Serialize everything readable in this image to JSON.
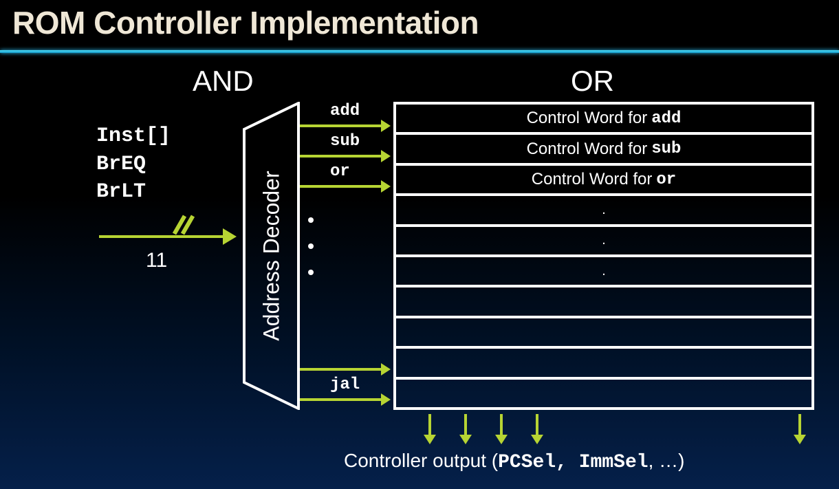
{
  "title": "ROM Controller Implementation",
  "plane_and_label": "AND",
  "plane_or_label": "OR",
  "inputs": {
    "line1": "Inst[]",
    "line2": "BrEQ",
    "line3": "BrLT"
  },
  "bus_width": "11",
  "decoder_label": "Address Decoder",
  "decoder_outputs": {
    "op0": "add",
    "op1": "sub",
    "op2": "or",
    "op_last": "jal"
  },
  "rom": {
    "row0_prefix": "Control Word for ",
    "row0_op": "add",
    "row1_prefix": "Control Word for ",
    "row1_op": "sub",
    "row2_prefix": "Control Word for ",
    "row2_op": "or",
    "row3": ".",
    "row4": ".",
    "row5": ".",
    "row6": "",
    "row7": "",
    "row8": "",
    "row9": ""
  },
  "output": {
    "prefix": "Controller output (",
    "sig1": "PCSel",
    "sep": ", ",
    "sig2": "ImmSel",
    "suffix": ", …)"
  }
}
